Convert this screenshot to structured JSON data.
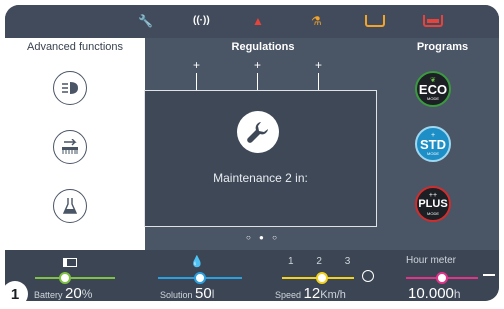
{
  "topbar": {
    "icons": [
      "wrench-icon",
      "signal-icon",
      "warning-icon",
      "flask-icon",
      "tank-icon",
      "tank-full-icon"
    ],
    "signal_text": "((·))"
  },
  "advanced": {
    "title": "Advanced functions",
    "items": [
      "headlight-icon",
      "brush-pressure-icon",
      "detergent-icon"
    ]
  },
  "regulations": {
    "title": "Regulations",
    "plus_labels": [
      "+",
      "+",
      "+"
    ]
  },
  "dialog": {
    "message": "Maintenance 2 in:",
    "page_dots": "○ ● ○"
  },
  "programs": {
    "title": "Programs",
    "items": [
      {
        "label": "ECO",
        "sub": "MODE",
        "prefix": ""
      },
      {
        "label": "STD",
        "sub": "MODE",
        "prefix": "+"
      },
      {
        "label": "PLUS",
        "sub": "MODE",
        "prefix": "++"
      }
    ]
  },
  "status": {
    "battery": {
      "label": "Battery",
      "value": "20",
      "unit": "%"
    },
    "solution": {
      "label": "Solution",
      "value": "50",
      "unit": "l"
    },
    "speed": {
      "label": "Speed",
      "value": "12",
      "unit": "Km/h",
      "steps": [
        "1",
        "2",
        "3"
      ]
    },
    "hour_meter": {
      "label": "Hour meter",
      "value": "10.000",
      "unit": "h"
    }
  },
  "badge": "1",
  "colors": {
    "battery": "#7fc142",
    "solution": "#2aa0e0",
    "speed": "#f2d21c",
    "hours": "#e2338b"
  }
}
